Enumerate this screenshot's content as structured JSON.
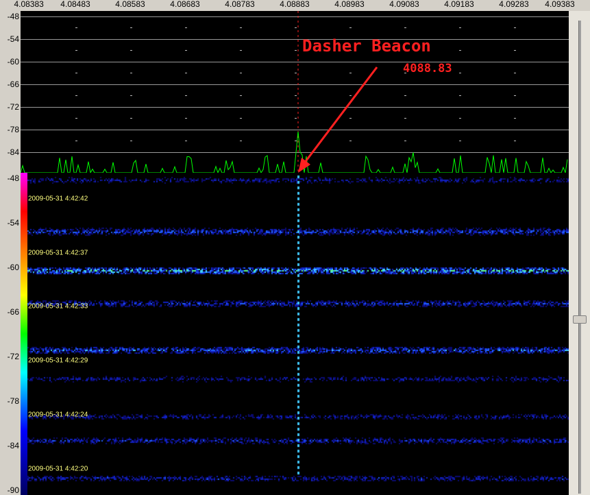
{
  "frequency_axis": {
    "labels": [
      "4.08383",
      "4.08483",
      "4.08583",
      "4.08683",
      "4.08783",
      "4.08883",
      "4.08983",
      "4.09083",
      "4.09183",
      "4.09283",
      "4.09383"
    ]
  },
  "spectrum_axis": {
    "labels": [
      "-48",
      "-54",
      "-60",
      "-66",
      "-72",
      "-78",
      "-84"
    ]
  },
  "waterfall_axis": {
    "labels": [
      "-48",
      "-54",
      "-60",
      "-66",
      "-72",
      "-78",
      "-84",
      "-90"
    ]
  },
  "timestamps": [
    "2009-05-31 4:42:42",
    "2009-05-31 4:42:37",
    "2009-05-31 4:42:33",
    "2009-05-31 4:42:29",
    "2009-05-31 4:42:24",
    "2009-05-31 4:42:20"
  ],
  "annotation": {
    "title": "Dasher Beacon",
    "frequency": "4088.83"
  },
  "colors": {
    "spectrum_trace": "#00ff00",
    "annotation": "#ff2020",
    "gridline": "#9a9a9a",
    "timestamp_text": "#ffff80"
  }
}
